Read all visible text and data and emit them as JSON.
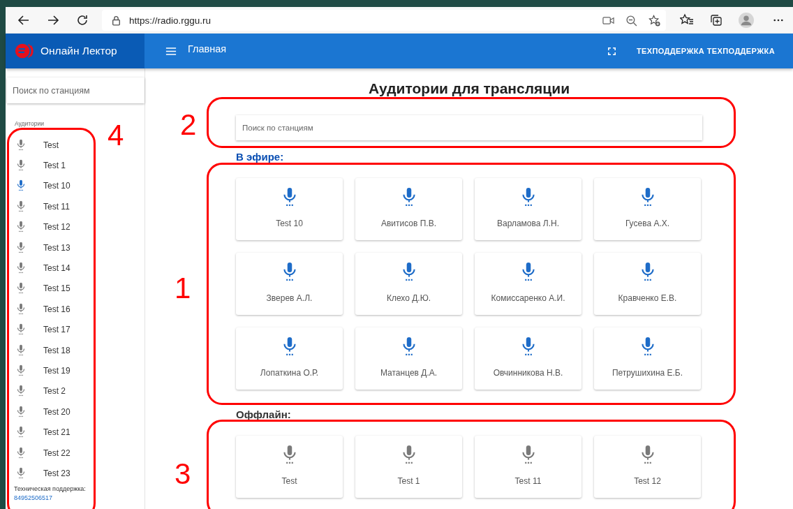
{
  "browser": {
    "url": "https://radio.rggu.ru"
  },
  "app_bar": {
    "brand": "Онлайн Лектор",
    "page_title": "Главная",
    "user_button": "ТЕХПОДДЕРЖКА ТЕХПОДДЕРЖКА"
  },
  "sidebar": {
    "search": {
      "placeholder": "Поиск по станциям"
    },
    "section_label": "Аудитории",
    "items": [
      {
        "label": "Test",
        "live": false
      },
      {
        "label": "Test 1",
        "live": false
      },
      {
        "label": "Test 10",
        "live": true
      },
      {
        "label": "Test 11",
        "live": false
      },
      {
        "label": "Test 12",
        "live": false
      },
      {
        "label": "Test 13",
        "live": false
      },
      {
        "label": "Test 14",
        "live": false
      },
      {
        "label": "Test 15",
        "live": false
      },
      {
        "label": "Test 16",
        "live": false
      },
      {
        "label": "Test 17",
        "live": false
      },
      {
        "label": "Test 18",
        "live": false
      },
      {
        "label": "Test 19",
        "live": false
      },
      {
        "label": "Test 2",
        "live": false
      },
      {
        "label": "Test 20",
        "live": false
      },
      {
        "label": "Test 21",
        "live": false
      },
      {
        "label": "Test 22",
        "live": false
      },
      {
        "label": "Test 23",
        "live": false
      }
    ],
    "support_label": "Техническая поддержка:",
    "support_phone": "84952506517"
  },
  "main": {
    "title": "Аудитории для трансляции",
    "search": {
      "placeholder": "Поиск по станциям"
    },
    "sections": [
      {
        "heading": "В эфире:",
        "live": true,
        "stations": [
          "Test 10",
          "Авитисов П.В.",
          "Варламова Л.Н.",
          "Гусева А.Х.",
          "Зверев А.Л.",
          "Клехо Д.Ю.",
          "Комиссаренко А.И.",
          "Кравченко Е.В.",
          "Лопаткина О.Р.",
          "Матанцев Д.А.",
          "Овчинникова Н.В.",
          "Петрушихина Е.Б."
        ]
      },
      {
        "heading": "Оффлайн:",
        "live": false,
        "stations": [
          "Test",
          "Test 1",
          "Test 11",
          "Test 12"
        ]
      }
    ]
  },
  "annotations": [
    {
      "number": "4"
    },
    {
      "number": "2"
    },
    {
      "number": "1"
    },
    {
      "number": "3"
    }
  ]
}
